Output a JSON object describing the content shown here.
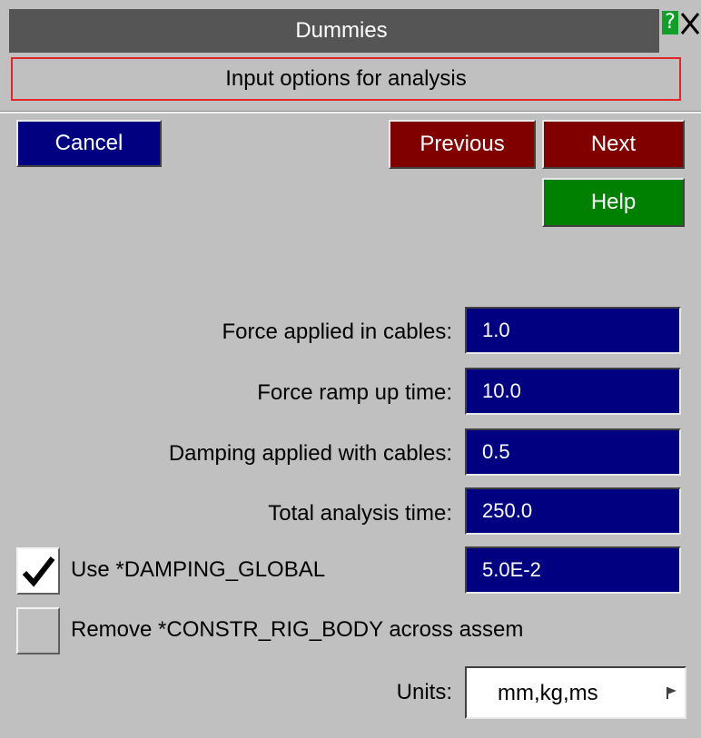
{
  "window": {
    "title": "Dummies",
    "subtitle": "Input options for analysis",
    "help_glyph": "?",
    "icons": {
      "help": "help-icon",
      "close": "close-icon"
    }
  },
  "buttons": {
    "cancel": "Cancel",
    "previous": "Previous",
    "next": "Next",
    "help": "Help"
  },
  "fields": {
    "force_cables": {
      "label": "Force applied in cables:",
      "value": "1.0"
    },
    "ramp_time": {
      "label": "Force ramp up time:",
      "value": "10.0"
    },
    "damping_cables": {
      "label": "Damping applied with cables:",
      "value": "0.5"
    },
    "total_time": {
      "label": "Total analysis time:",
      "value": "250.0"
    }
  },
  "options": {
    "damping_global": {
      "label": "Use *DAMPING_GLOBAL",
      "checked": true,
      "value": "5.0E-2"
    },
    "remove_constr": {
      "label": "Remove *CONSTR_RIG_BODY across assem",
      "checked": false
    }
  },
  "units": {
    "label": "Units:",
    "value": "mm,kg,ms"
  },
  "colors": {
    "background": "#c0c0c0",
    "titlebar": "#555555",
    "field_blue": "#000080",
    "button_red": "#800000",
    "button_green": "#008000",
    "subtitle_border": "#e02626"
  }
}
